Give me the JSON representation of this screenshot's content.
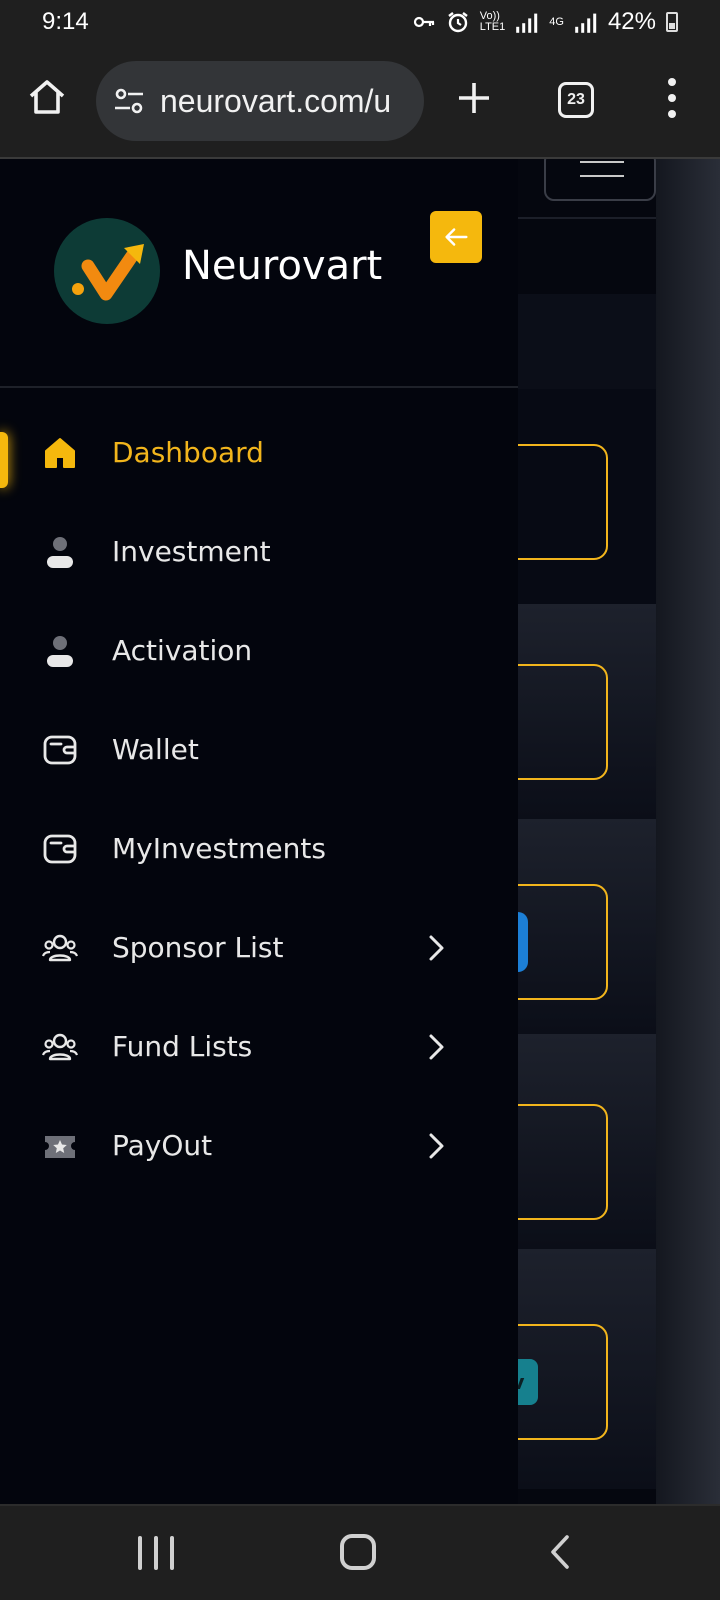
{
  "status_bar": {
    "time": "9:14",
    "network_labels": [
      "Vo))",
      "LTE1",
      "4G"
    ],
    "battery_percent": "42%",
    "icons": [
      "key-icon",
      "alarm-icon",
      "signal-icon",
      "signal-icon",
      "battery-icon"
    ]
  },
  "browser": {
    "url": "neurovart.com/u",
    "tab_count": "23",
    "icons": [
      "home-icon",
      "site-settings-icon",
      "new-tab-icon",
      "tabs-icon",
      "more-icon"
    ]
  },
  "sidebar": {
    "brand_name": "Neurovart",
    "logo_colors": {
      "background": "#0d3b36",
      "accent": "#f5a20d"
    },
    "collapse_icon": "arrow-left-icon",
    "items": [
      {
        "label": "Dashboard",
        "icon": "home-icon",
        "active": true,
        "has_submenu": false
      },
      {
        "label": "Investment",
        "icon": "user-icon",
        "active": false,
        "has_submenu": false
      },
      {
        "label": "Activation",
        "icon": "user-icon",
        "active": false,
        "has_submenu": false
      },
      {
        "label": "Wallet",
        "icon": "wallet-icon",
        "active": false,
        "has_submenu": false
      },
      {
        "label": "MyInvestments",
        "icon": "wallet-icon",
        "active": false,
        "has_submenu": false
      },
      {
        "label": "Sponsor List",
        "icon": "users-icon",
        "active": false,
        "has_submenu": true
      },
      {
        "label": "Fund Lists",
        "icon": "users-icon",
        "active": false,
        "has_submenu": true
      },
      {
        "label": "PayOut",
        "icon": "ticket-star-icon",
        "active": false,
        "has_submenu": true
      }
    ]
  },
  "colors": {
    "accent": "#f5b80d",
    "drawer_bg": "#03050d",
    "text": "#e8e8e8"
  },
  "page_behind": {
    "teal_chip_text": "v"
  },
  "system_nav": {
    "icons": [
      "recent-apps-icon",
      "home-button-icon",
      "back-icon"
    ]
  }
}
